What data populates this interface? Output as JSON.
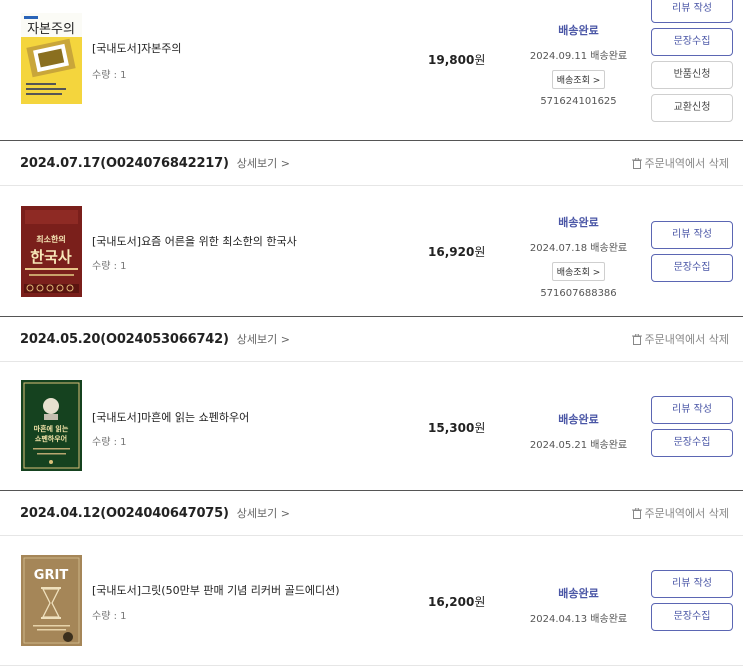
{
  "orders": [
    {
      "items": [
        {
          "title": "[국내도서]자본주의",
          "qty": "수량 : 1",
          "price": "19,800",
          "won": "원",
          "status": "배송완료",
          "ship_date": "2024.09.11 배송완료",
          "track_label": "배송조회 >",
          "tracking_no": "571624101625",
          "buttons": [
            "리뷰 작성",
            "문장수집",
            "반품신청",
            "교환신청"
          ],
          "cover": {
            "bg": "#f3d23a",
            "title": "자본주의"
          }
        }
      ]
    },
    {
      "date": "2024.07.17(O024076842217)",
      "detail": "상세보기 >",
      "delete": "주문내역에서 삭제",
      "items": [
        {
          "title": "[국내도서]요즘 어른을 위한 최소한의 한국사",
          "qty": "수량 : 1",
          "price": "16,920",
          "won": "원",
          "status": "배송완료",
          "ship_date": "2024.07.18 배송완료",
          "track_label": "배송조회 >",
          "tracking_no": "571607688386",
          "buttons": [
            "리뷰 작성",
            "문장수집"
          ],
          "cover": {
            "bg": "#7a1f1b",
            "title": "최소한의 한국사"
          }
        }
      ]
    },
    {
      "date": "2024.05.20(O024053066742)",
      "detail": "상세보기 >",
      "delete": "주문내역에서 삭제",
      "items": [
        {
          "title": "[국내도서]마흔에 읽는 쇼펜하우어",
          "qty": "수량 : 1",
          "price": "15,300",
          "won": "원",
          "status": "배송완료",
          "ship_date": "2024.05.21 배송완료",
          "buttons": [
            "리뷰 작성",
            "문장수집"
          ],
          "cover": {
            "bg": "#15421f",
            "title": "마흔에 읽는 쇼펜하우어"
          }
        }
      ]
    },
    {
      "date": "2024.04.12(O024040647075)",
      "detail": "상세보기 >",
      "delete": "주문내역에서 삭제",
      "items": [
        {
          "title": "[국내도서]그릿(50만부 판매 기념 리커버 골드에디션)",
          "qty": "수량 : 1",
          "price": "16,200",
          "won": "원",
          "status": "배송완료",
          "ship_date": "2024.04.13 배송완료",
          "buttons": [
            "리뷰 작성",
            "문장수집"
          ],
          "cover": {
            "bg": "#a58658",
            "title": "GRIT"
          }
        }
      ]
    }
  ]
}
